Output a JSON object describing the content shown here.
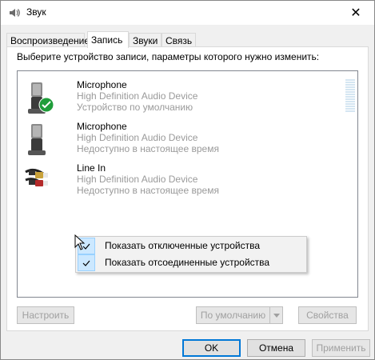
{
  "window": {
    "title": "Звук",
    "close_glyph": "✕"
  },
  "tabs": [
    {
      "label": "Воспроизведение",
      "active": false
    },
    {
      "label": "Запись",
      "active": true
    },
    {
      "label": "Звуки",
      "active": false
    },
    {
      "label": "Связь",
      "active": false
    }
  ],
  "panel": {
    "instruction": "Выберите устройство записи, параметры которого нужно изменить:"
  },
  "devices": [
    {
      "name": "Microphone",
      "driver": "High Definition Audio Device",
      "status": "Устройство по умолчанию",
      "icon": "microphone-icon",
      "default": true
    },
    {
      "name": "Microphone",
      "driver": "High Definition Audio Device",
      "status": "Недоступно в настоящее время",
      "icon": "microphone-icon",
      "default": false
    },
    {
      "name": "Line In",
      "driver": "High Definition Audio Device",
      "status": "Недоступно в настоящее время",
      "icon": "line-in-cable-icon",
      "default": false
    }
  ],
  "context_menu": {
    "items": [
      {
        "label": "Показать отключенные устройства",
        "checked": true
      },
      {
        "label": "Показать отсоединенные устройства",
        "checked": true
      }
    ]
  },
  "panel_buttons": {
    "configure": "Настроить",
    "set_default": "По умолчанию",
    "properties": "Свойства"
  },
  "dialog_buttons": {
    "ok": "OK",
    "cancel": "Отмена",
    "apply": "Применить"
  },
  "colors": {
    "accent": "#0078d7",
    "check_green": "#1f9d3a",
    "menu_highlight": "#cce8ff",
    "disabled_text": "#a0a0a0"
  }
}
